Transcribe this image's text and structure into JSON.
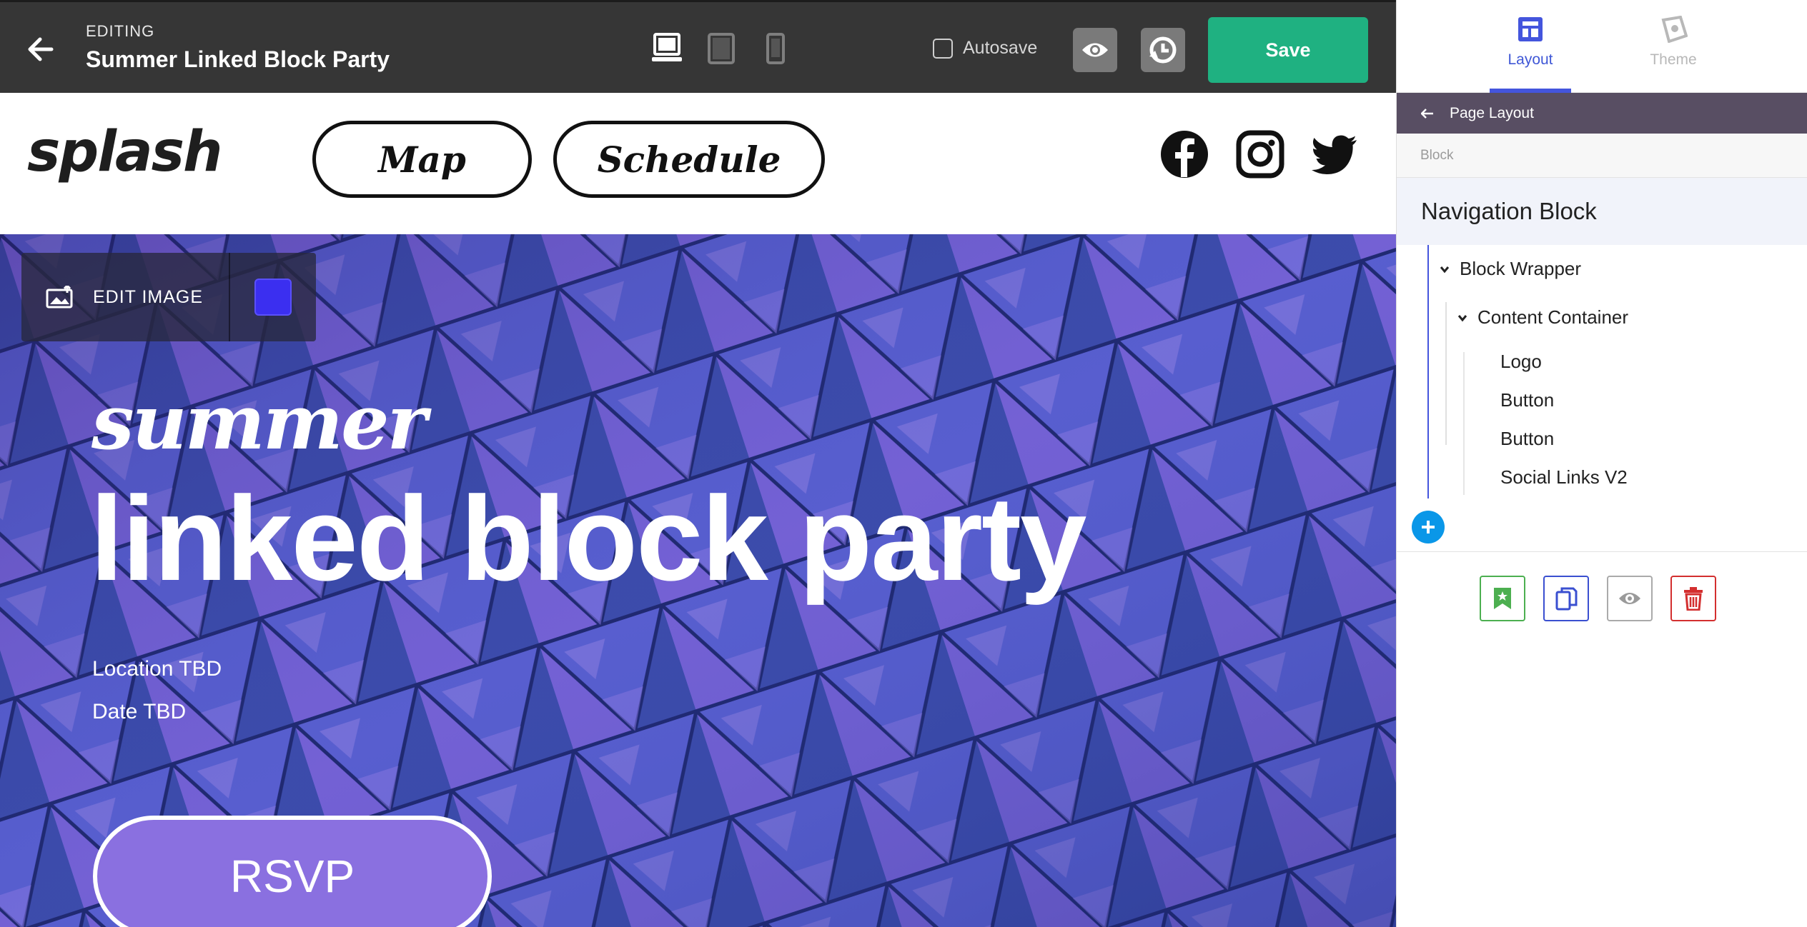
{
  "editor": {
    "editing_label": "EDITING",
    "page_name": "Summer Linked Block Party",
    "autosave_label": "Autosave",
    "save_label": "Save",
    "devices": [
      "desktop-icon",
      "tablet-icon",
      "mobile-icon"
    ]
  },
  "site": {
    "logo": "splash",
    "nav_buttons": [
      "Map",
      "Schedule"
    ],
    "social": [
      "facebook-icon",
      "instagram-icon",
      "twitter-icon"
    ]
  },
  "hero": {
    "edit_image_label": "EDIT IMAGE",
    "swatch_color": "#3b2ff0",
    "script_title": "summer",
    "title": "linked block party",
    "location": "Location TBD",
    "date": "Date TBD",
    "rsvp_label": "RSVP"
  },
  "panel": {
    "tabs": [
      {
        "label": "Layout",
        "active": true
      },
      {
        "label": "Theme",
        "active": false
      }
    ],
    "crumb": "Page Layout",
    "block_label": "Block",
    "block_title": "Navigation Block",
    "tree": [
      {
        "label": "Block Wrapper",
        "level": 0,
        "expanded": true
      },
      {
        "label": "Content Container",
        "level": 1,
        "expanded": true
      },
      {
        "label": "Logo",
        "level": 2
      },
      {
        "label": "Button",
        "level": 2
      },
      {
        "label": "Button",
        "level": 2
      },
      {
        "label": "Social Links V2",
        "level": 2
      }
    ],
    "actions": [
      "bookmark-icon",
      "copy-icon",
      "eye-icon",
      "trash-icon"
    ]
  },
  "colors": {
    "save_green": "#1fb181",
    "accent_blue": "#4455dd",
    "crumb_bg": "#584e63",
    "rsvp_purple": "#8a70e0"
  }
}
